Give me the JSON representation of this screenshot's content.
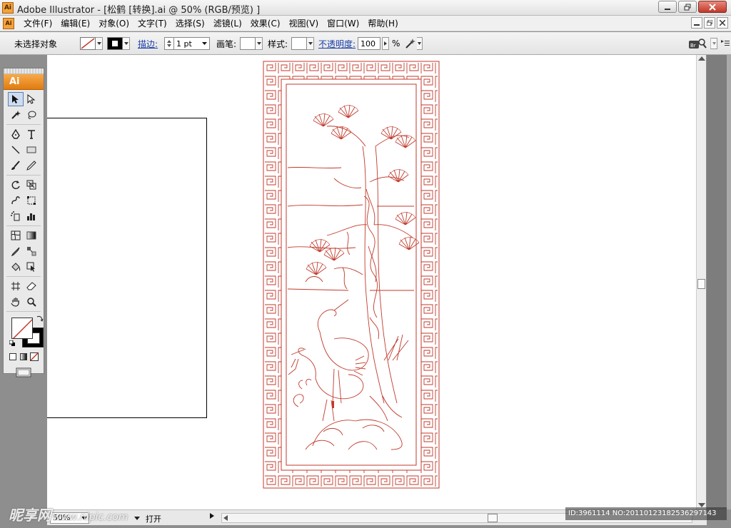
{
  "window": {
    "title": "Adobe Illustrator - [松鹤 [转换].ai @ 50% (RGB/预览) ]",
    "app_icon": "Ai"
  },
  "menu": {
    "items": [
      "文件(F)",
      "编辑(E)",
      "对象(O)",
      "文字(T)",
      "选择(S)",
      "滤镜(L)",
      "效果(C)",
      "视图(V)",
      "窗口(W)",
      "帮助(H)"
    ]
  },
  "control": {
    "selection_status": "未选择对象",
    "stroke_label": "描边:",
    "stroke_weight": "1 pt",
    "brush_label": "画笔:",
    "style_label": "样式:",
    "opacity_label": "不透明度:",
    "opacity_value": "100",
    "opacity_unit": "%"
  },
  "toolbox": {
    "header": "Ai"
  },
  "status": {
    "zoom": "50%",
    "label": "打开"
  },
  "watermark": {
    "site": "昵享网",
    "url": "www.nipic.com",
    "id_text": "ID:3961114 NO:20110123182536297143"
  },
  "colors": {
    "artwork_stroke": "#c0392b",
    "toolbox_header": "#e07c10"
  }
}
